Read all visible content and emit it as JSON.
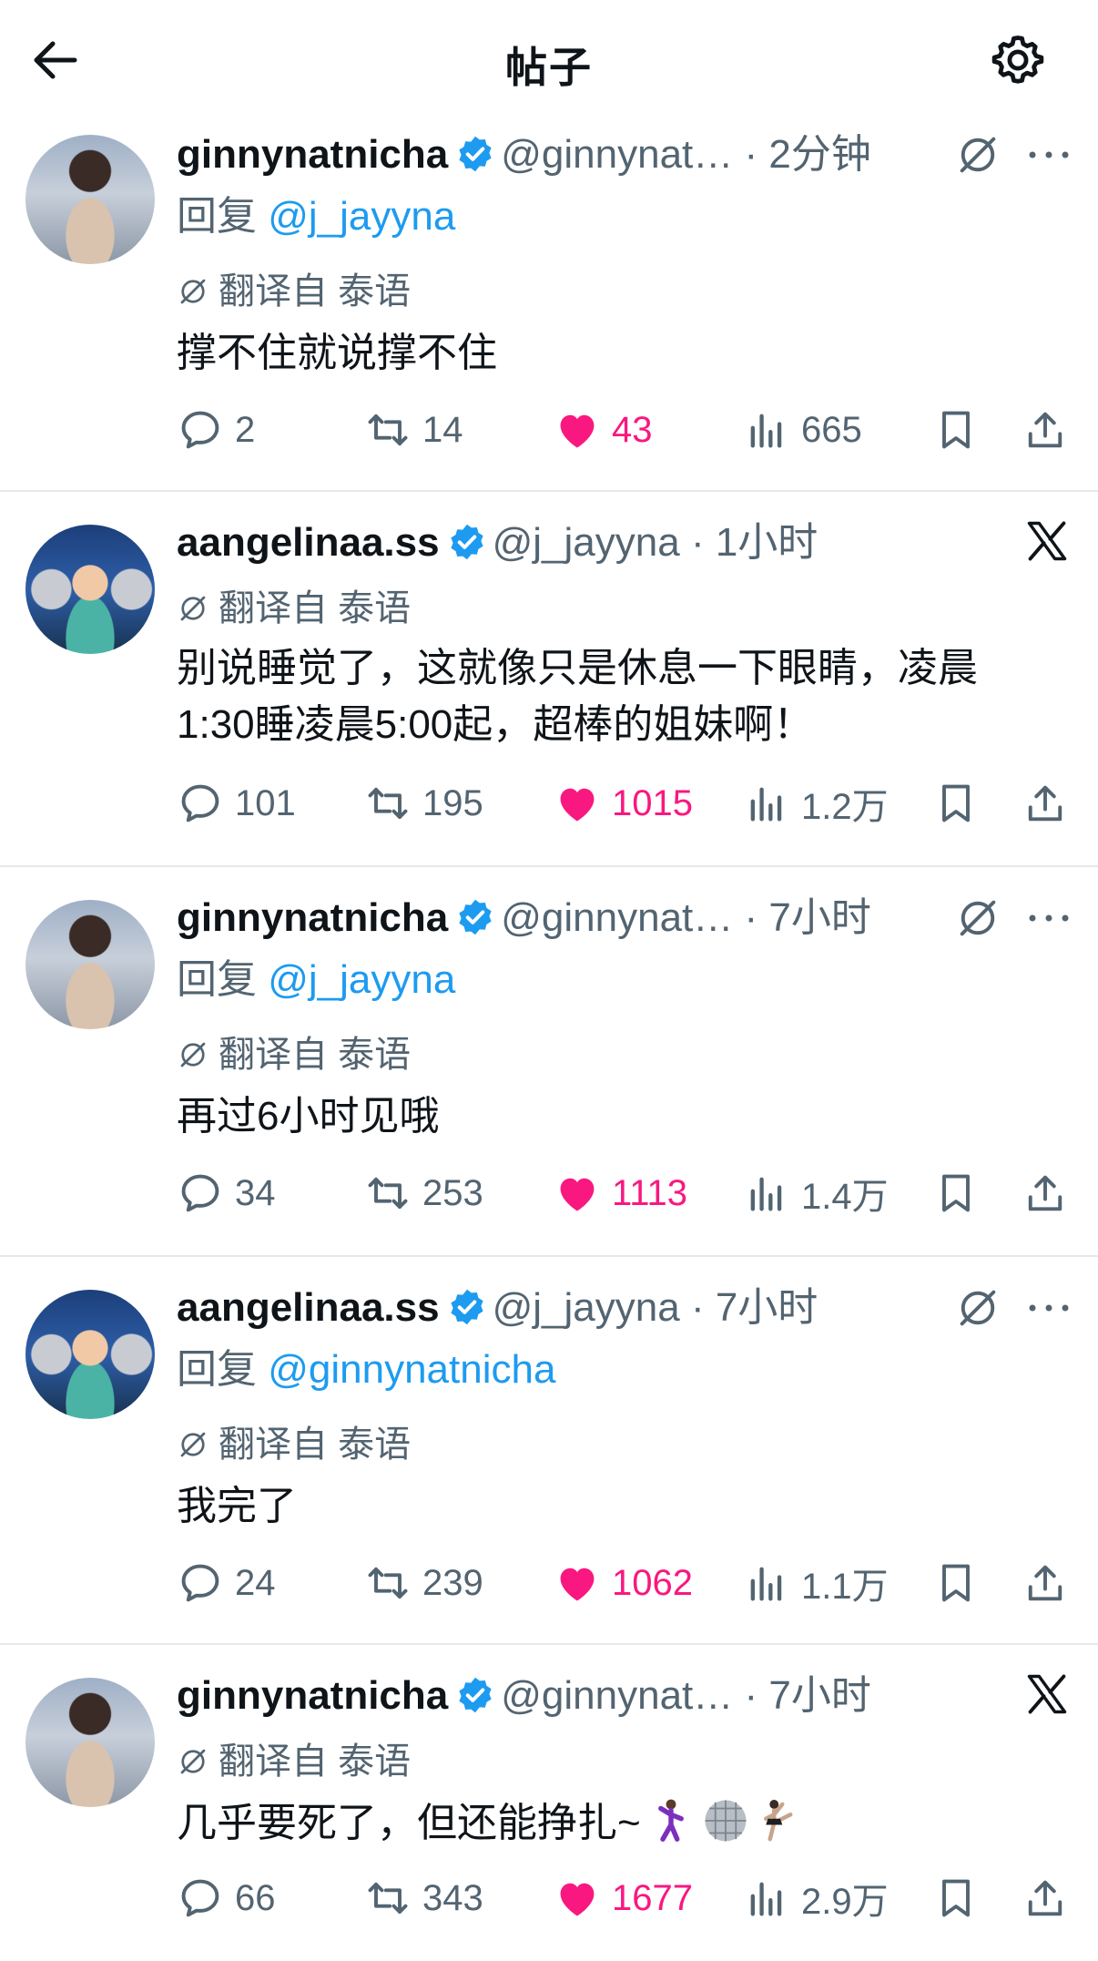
{
  "header": {
    "title": "帖子",
    "back_icon": "arrow-left-icon",
    "settings_icon": "gear-icon"
  },
  "colors": {
    "accent": "#1d9bf0",
    "like": "#f91880",
    "muted": "#536471",
    "text": "#0f1419"
  },
  "tweets": [
    {
      "name": "ginnynatnicha",
      "handle": "@ginnynat…",
      "time": "2分钟",
      "reply_prefix": "回复 ",
      "reply_to": "@j_jayyna",
      "translate": "翻译自 泰语",
      "text": "撑不住就说撑不住",
      "top_icon": "grok",
      "replies": "2",
      "retweets": "14",
      "likes": "43",
      "views": "665"
    },
    {
      "name": "aangelinaa.ss",
      "handle": "@j_jayyna",
      "time": "1小时",
      "translate": "翻译自 泰语",
      "text_line1": "别说睡觉了，这就像只是休息一下眼睛，凌晨",
      "text_line2": "1:30睡凌晨5:00起，超棒的姐妹啊！",
      "top_icon": "x",
      "replies": "101",
      "retweets": "195",
      "likes": "1015",
      "views": "1.2万"
    },
    {
      "name": "ginnynatnicha",
      "handle": "@ginnynat…",
      "time": "7小时",
      "reply_prefix": "回复 ",
      "reply_to": "@j_jayyna",
      "translate": "翻译自 泰语",
      "text": "再过6小时见哦",
      "top_icon": "grok",
      "replies": "34",
      "retweets": "253",
      "likes": "1113",
      "views": "1.4万"
    },
    {
      "name": "aangelinaa.ss",
      "handle": "@j_jayyna",
      "time": "7小时",
      "reply_prefix": "回复 ",
      "reply_to": "@ginnynatnicha",
      "translate": "翻译自 泰语",
      "text": "我完了",
      "top_icon": "grok",
      "replies": "24",
      "retweets": "239",
      "likes": "1062",
      "views": "1.1万"
    },
    {
      "name": "ginnynatnicha",
      "handle": "@ginnynat…",
      "time": "7小时",
      "translate": "翻译自 泰语",
      "text": "几乎要死了，但还能挣扎~",
      "emojis": [
        "dancing-man-icon",
        "mirror-ball-icon",
        "ballet-dancer-icon"
      ],
      "top_icon": "x",
      "replies": "66",
      "retweets": "343",
      "likes": "1677",
      "views": "2.9万"
    }
  ]
}
